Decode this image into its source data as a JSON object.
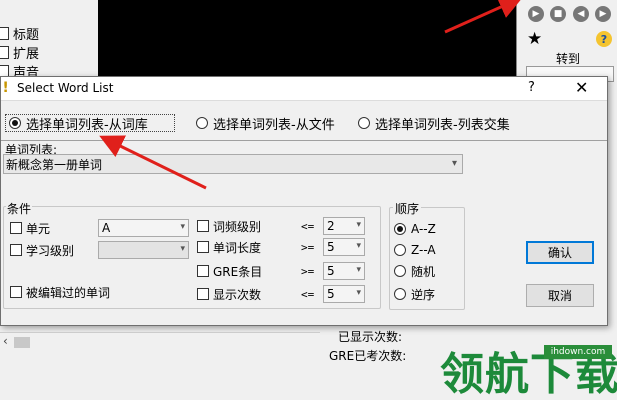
{
  "background": {
    "checkboxes": [
      "标题",
      "扩展",
      "声音"
    ],
    "goto_label": "转到"
  },
  "dialog": {
    "title": "Select Word List",
    "help_label": "?",
    "close_label": "✕",
    "sources": [
      {
        "label": "选择单词列表-从词库",
        "selected": true
      },
      {
        "label": "选择单词列表-从文件",
        "selected": false
      },
      {
        "label": "选择单词列表-列表交集",
        "selected": false
      }
    ],
    "list_label": "单词列表:",
    "list_value": "新概念第一册单词",
    "conditions": {
      "title": "条件",
      "unit_label": "单元",
      "unit_value": "A",
      "level_label": "学习级别",
      "level_value": "",
      "edited_label": "被编辑过的单词",
      "rows": [
        {
          "label": "词频级别",
          "op": "<=",
          "value": "2"
        },
        {
          "label": "单词长度",
          "op": ">=",
          "value": "5"
        },
        {
          "label": "GRE条目",
          "op": ">=",
          "value": "5"
        },
        {
          "label": "显示次数",
          "op": "<=",
          "value": "5"
        }
      ]
    },
    "order": {
      "title": "顺序",
      "options": [
        {
          "label": "A--Z",
          "selected": true
        },
        {
          "label": "Z--A",
          "selected": false
        },
        {
          "label": "随机",
          "selected": false
        },
        {
          "label": "逆序",
          "selected": false
        }
      ]
    },
    "ok_label": "确认",
    "cancel_label": "取消"
  },
  "status": {
    "shown_count_label": "已显示次数:",
    "gre_count_label": "GRE已考次数:"
  },
  "watermark": {
    "text": "领航下载",
    "url": "ihdown.com"
  },
  "colors": {
    "arrow": "#e0201b",
    "watermark": "#1d8a3a",
    "accent": "#0078d7"
  }
}
